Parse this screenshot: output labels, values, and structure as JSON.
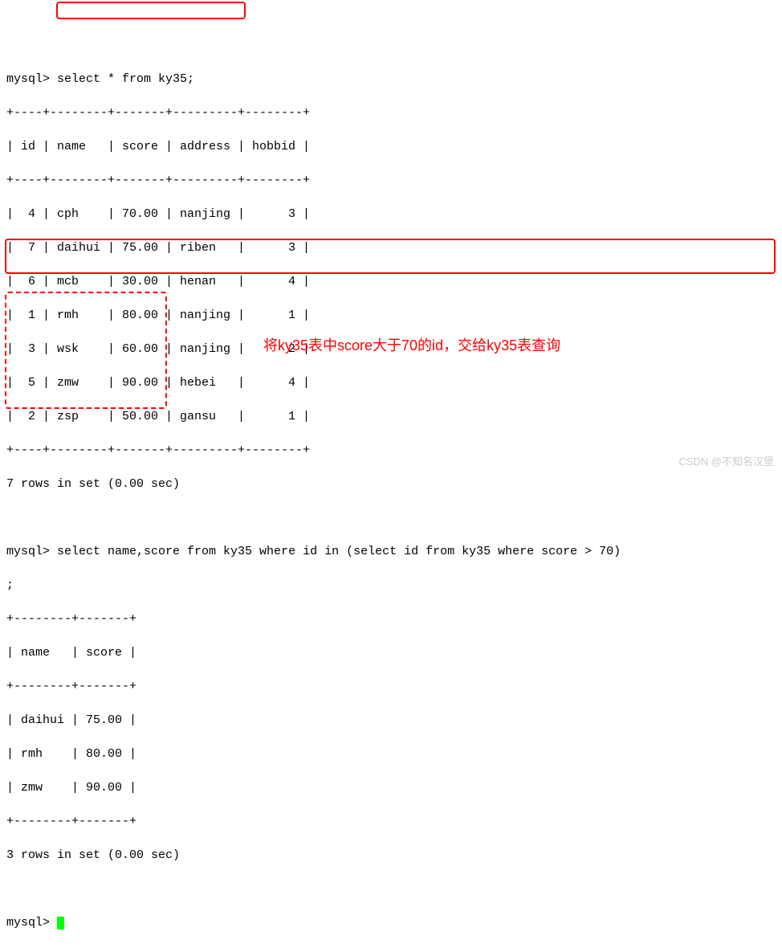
{
  "prompt_prefix": "mysql> ",
  "query1": "select * from ky35;",
  "table1_border_top": "+----+--------+-------+---------+--------+",
  "table1_headers": "| id | name   | score | address | hobbid |",
  "table1_border_mid": "+----+--------+-------+---------+--------+",
  "table1_rows": [
    "|  4 | cph    | 70.00 | nanjing |      3 |",
    "|  7 | daihui | 75.00 | riben   |      3 |",
    "|  6 | mcb    | 30.00 | henan   |      4 |",
    "|  1 | rmh    | 80.00 | nanjing |      1 |",
    "|  3 | wsk    | 60.00 | nanjing |      2 |",
    "|  5 | zmw    | 90.00 | hebei   |      4 |",
    "|  2 | zsp    | 50.00 | gansu   |      1 |"
  ],
  "table1_border_bot": "+----+--------+-------+---------+--------+",
  "result1": "7 rows in set (0.00 sec)",
  "query2_line1": "select name,score from ky35 where id in (select id from ky35 where score > 70)",
  "query2_line2": ";",
  "table2_border_top": "+--------+-------+",
  "table2_headers": "| name   | score |",
  "table2_border_mid": "+--------+-------+",
  "table2_rows": [
    "| daihui | 75.00 |",
    "| rmh    | 80.00 |",
    "| zmw    | 90.00 |"
  ],
  "table2_border_bot": "+--------+-------+",
  "result2": "3 rows in set (0.00 sec)",
  "annotation_text": "将ky35表中score大于70的id，交给ky35表查询",
  "watermark": "CSDN @不知名汉堡"
}
